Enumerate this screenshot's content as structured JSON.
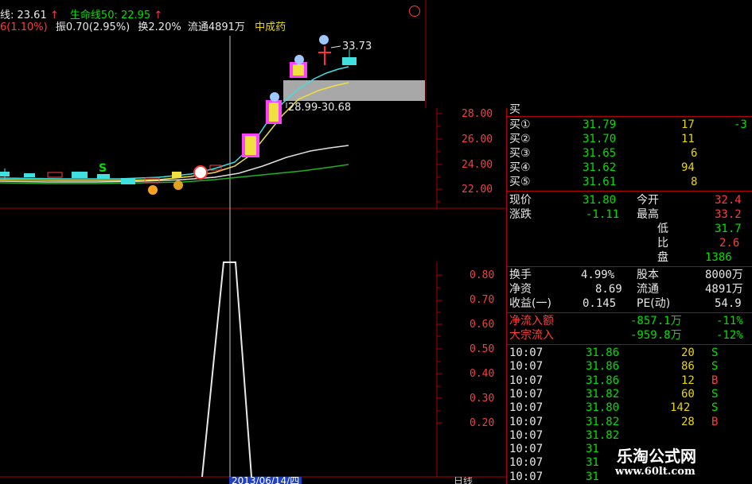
{
  "header": {
    "line1_ma": "线: 23.61",
    "line1_life": "生命线50: 22.95",
    "arrow": "↑",
    "line2_change": "6(1.10%)",
    "line2_amp": "振0.70(2.95%)",
    "line2_turn": "换2.20%",
    "line2_float": "流通4891万",
    "line2_name": "中成药"
  },
  "main_chart": {
    "price_high_label": "33.73",
    "range_label": "28.99-30.68",
    "marker_s": "S",
    "y_ticks": [
      "28.00",
      "26.00",
      "24.00",
      "22.00"
    ],
    "colors": {
      "ma1": "#40e0e0",
      "ma2": "#f0e040",
      "ma3": "#e0e0e0",
      "ma4": "#20c020",
      "bull": "#ff40ff"
    }
  },
  "sub_chart": {
    "y_ticks": [
      "0.80",
      "0.70",
      "0.60",
      "0.50",
      "0.40",
      "0.30",
      "0.20"
    ],
    "date_label": "2013/06/14/四"
  },
  "order_book": [
    {
      "label": "买①",
      "price": "31.79",
      "vol": "17",
      "chg": "-3"
    },
    {
      "label": "买②",
      "price": "31.70",
      "vol": "11",
      "chg": ""
    },
    {
      "label": "买③",
      "price": "31.65",
      "vol": "6",
      "chg": ""
    },
    {
      "label": "买④",
      "price": "31.62",
      "vol": "94",
      "chg": ""
    },
    {
      "label": "买⑤",
      "price": "31.61",
      "vol": "8",
      "chg": ""
    }
  ],
  "quote": {
    "rows": [
      {
        "l1": "现价",
        "v1": "31.80",
        "l2": "今开",
        "v2": "32.4"
      },
      {
        "l1": "涨跌",
        "v1": "-1.11",
        "l2": "最高",
        "v2": "33.2"
      },
      {
        "l1": "",
        "v1": "",
        "l2": "低",
        "v2": "31.7"
      },
      {
        "l1": "",
        "v1": "",
        "l2": "比",
        "v2": "2.6"
      },
      {
        "l1": "",
        "v1": "",
        "l2": "盘",
        "v2": "1386"
      }
    ]
  },
  "fundamentals": [
    {
      "l1": "换手",
      "v1": "4.99%",
      "l2": "股本",
      "v2": "8000万"
    },
    {
      "l1": "净资",
      "v1": "8.69",
      "l2": "流通",
      "v2": "4891万"
    },
    {
      "l1": "收益(一)",
      "v1": "0.145",
      "l2": "PE(动)",
      "v2": "54.9"
    }
  ],
  "flows": [
    {
      "label": "净流入额",
      "value": "-857.1万",
      "pct": "-11%"
    },
    {
      "label": "大宗流入",
      "value": "-959.8万",
      "pct": "-12%"
    }
  ],
  "ticks": [
    {
      "time": "10:07",
      "price": "31.86",
      "vol": "20",
      "side": "S"
    },
    {
      "time": "10:07",
      "price": "31.86",
      "vol": "86",
      "side": "S"
    },
    {
      "time": "10:07",
      "price": "31.86",
      "vol": "12",
      "side": "B"
    },
    {
      "time": "10:07",
      "price": "31.82",
      "vol": "60",
      "side": "S"
    },
    {
      "time": "10:07",
      "price": "31.80",
      "vol": "142",
      "side": "S"
    },
    {
      "time": "10:07",
      "price": "31.82",
      "vol": "28",
      "side": "B"
    },
    {
      "time": "10:07",
      "price": "31.82",
      "vol": "",
      "side": ""
    },
    {
      "time": "10:07",
      "price": "31",
      "vol": "",
      "side": ""
    },
    {
      "time": "10:07",
      "price": "31",
      "vol": "",
      "side": ""
    },
    {
      "time": "10:07",
      "price": "31",
      "vol": "",
      "side": ""
    }
  ],
  "watermark": {
    "title": "乐淘公式网",
    "url": "www.60lt.com"
  },
  "bottom_tab": "日线"
}
